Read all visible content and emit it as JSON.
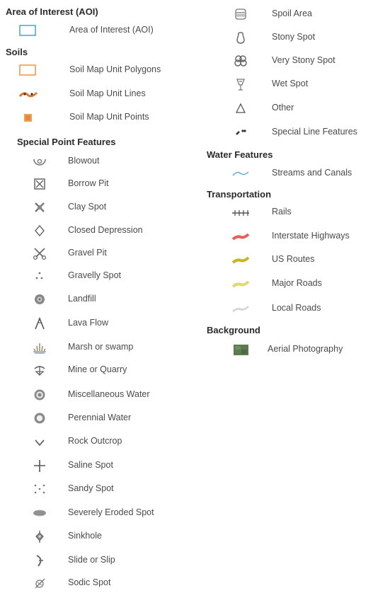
{
  "aoi": {
    "heading": "Area of Interest (AOI)",
    "items": [
      {
        "label": "Area of Interest (AOI)",
        "icon": "aoi-polygon-icon",
        "color": "#3a9ad9"
      }
    ]
  },
  "soils": {
    "heading": "Soils",
    "items": [
      {
        "label": "Soil Map Unit Polygons",
        "icon": "soil-polygon-icon",
        "color": "#f08c32"
      },
      {
        "label": "Soil Map Unit Lines",
        "icon": "soil-line-icon",
        "color": "#e07828"
      },
      {
        "label": "Soil Map Unit Points",
        "icon": "soil-point-icon",
        "color": "#f0a050"
      }
    ]
  },
  "special_points": {
    "heading": "Special Point Features",
    "items": [
      {
        "label": "Blowout",
        "icon": "blowout-icon"
      },
      {
        "label": "Borrow Pit",
        "icon": "borrow-pit-icon"
      },
      {
        "label": "Clay Spot",
        "icon": "clay-spot-icon"
      },
      {
        "label": "Closed Depression",
        "icon": "closed-depression-icon"
      },
      {
        "label": "Gravel Pit",
        "icon": "gravel-pit-icon"
      },
      {
        "label": "Gravelly Spot",
        "icon": "gravelly-spot-icon"
      },
      {
        "label": "Landfill",
        "icon": "landfill-icon"
      },
      {
        "label": "Lava Flow",
        "icon": "lava-flow-icon"
      },
      {
        "label": "Marsh or swamp",
        "icon": "marsh-icon"
      },
      {
        "label": "Mine or Quarry",
        "icon": "mine-quarry-icon"
      },
      {
        "label": "Miscellaneous Water",
        "icon": "misc-water-icon"
      },
      {
        "label": "Perennial Water",
        "icon": "perennial-water-icon"
      },
      {
        "label": "Rock Outcrop",
        "icon": "rock-outcrop-icon"
      },
      {
        "label": "Saline Spot",
        "icon": "saline-spot-icon"
      },
      {
        "label": "Sandy Spot",
        "icon": "sandy-spot-icon"
      },
      {
        "label": "Severely Eroded Spot",
        "icon": "eroded-spot-icon"
      },
      {
        "label": "Sinkhole",
        "icon": "sinkhole-icon"
      },
      {
        "label": "Slide or Slip",
        "icon": "slide-slip-icon"
      },
      {
        "label": "Sodic Spot",
        "icon": "sodic-spot-icon"
      }
    ]
  },
  "misc": {
    "items": [
      {
        "label": "Spoil Area",
        "icon": "spoil-area-icon"
      },
      {
        "label": "Stony Spot",
        "icon": "stony-spot-icon"
      },
      {
        "label": "Very Stony Spot",
        "icon": "very-stony-spot-icon"
      },
      {
        "label": "Wet Spot",
        "icon": "wet-spot-icon"
      },
      {
        "label": "Other",
        "icon": "other-triangle-icon"
      },
      {
        "label": "Special Line Features",
        "icon": "special-line-icon"
      }
    ]
  },
  "water": {
    "heading": "Water Features",
    "items": [
      {
        "label": "Streams and Canals",
        "icon": "stream-icon",
        "color": "#6aaee0"
      }
    ]
  },
  "transportation": {
    "heading": "Transportation",
    "items": [
      {
        "label": "Rails",
        "icon": "rails-icon",
        "color": "#555555"
      },
      {
        "label": "Interstate Highways",
        "icon": "interstate-icon",
        "color": "#e8605a"
      },
      {
        "label": "US Routes",
        "icon": "us-routes-icon",
        "color": "#c8b420"
      },
      {
        "label": "Major Roads",
        "icon": "major-roads-icon",
        "color": "#e0d870"
      },
      {
        "label": "Local Roads",
        "icon": "local-roads-icon",
        "color": "#d8d8d8"
      }
    ]
  },
  "background": {
    "heading": "Background",
    "items": [
      {
        "label": "Aerial Photography",
        "icon": "aerial-photo-icon",
        "color": "#5a7a50"
      }
    ]
  }
}
